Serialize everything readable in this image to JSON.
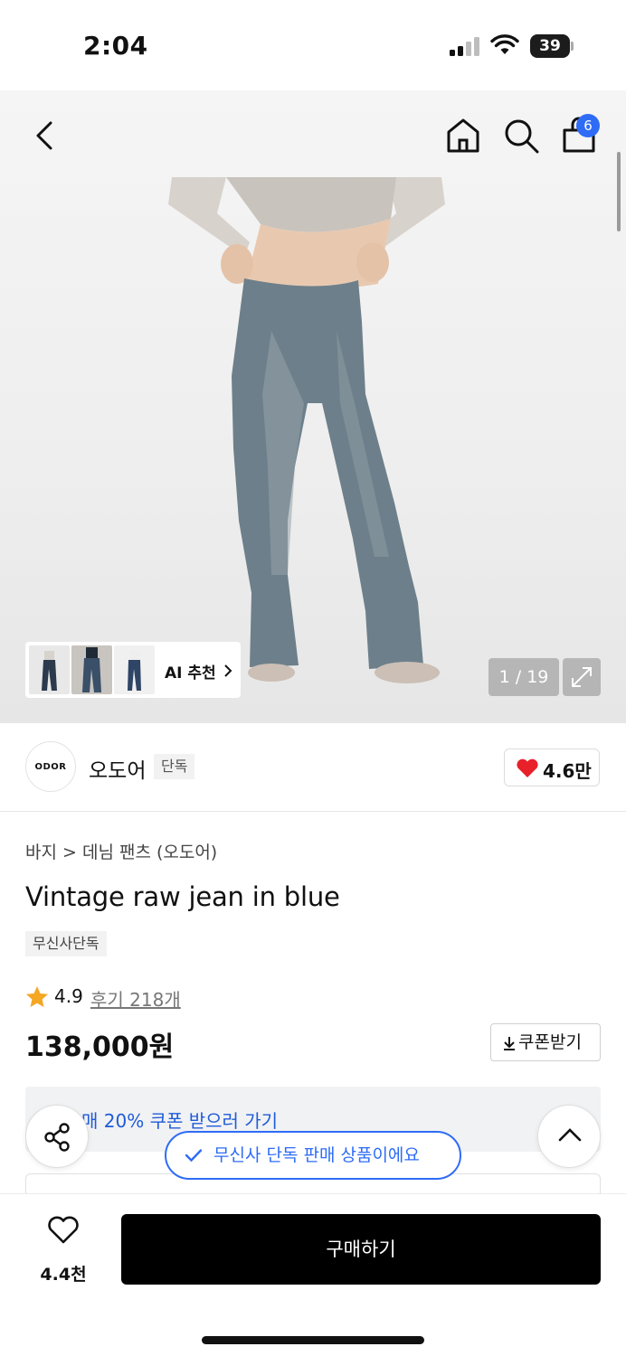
{
  "status_bar": {
    "time": "2:04",
    "battery": "39"
  },
  "nav": {
    "cart_count": "6"
  },
  "gallery": {
    "ai_label": "AI 추천",
    "counter": "1 / 19"
  },
  "brand": {
    "logo_text": "ODOR",
    "name": "오도어",
    "tag": "단독",
    "likes": "4.6만"
  },
  "product": {
    "breadcrumb": "바지 > 데님 팬츠 (오도어)",
    "title": "Vintage raw jean in blue",
    "exclusive_badge": "무신사단독",
    "rating": "4.9",
    "reviews": "후기 218개",
    "price": "138,000원",
    "coupon_button": "쿠폰받기",
    "coupon_banner": "매 20% 쿠폰 받으러 가기"
  },
  "toast": "무신사 단독 판매 상품이에요",
  "bottom": {
    "wish_count": "4.4천",
    "buy_label": "구매하기"
  },
  "colors": {
    "accent": "#2e6cf6",
    "heart": "#e8202a",
    "star": "#f5a623",
    "buy": "#000000"
  }
}
